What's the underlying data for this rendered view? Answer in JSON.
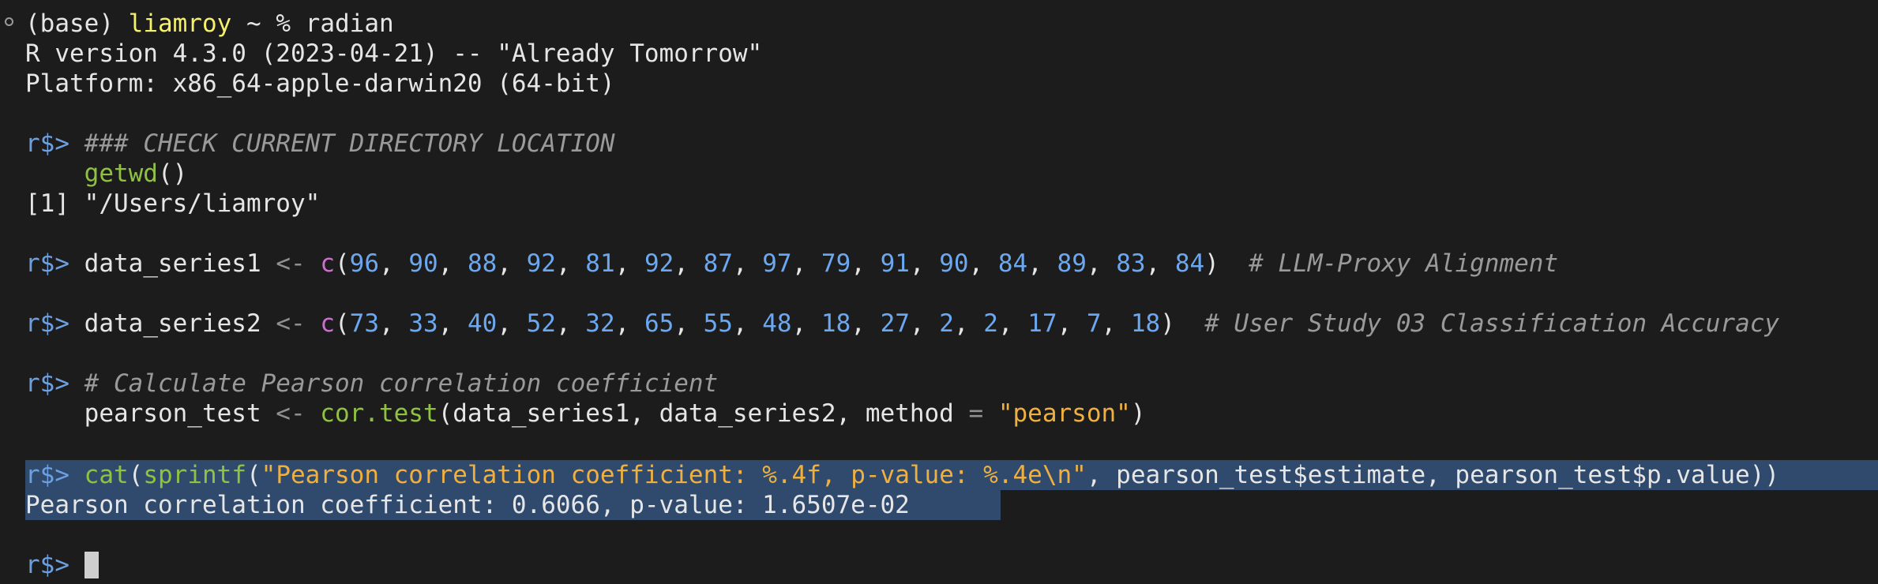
{
  "shell": {
    "env": "(base)",
    "user": "liamroy",
    "dir": "~",
    "symbol": "%",
    "command": "radian"
  },
  "banner": {
    "version": "R version 4.3.0 (2023-04-21) -- \"Already Tomorrow\"",
    "platform": "Platform: x86_64-apple-darwin20 (64-bit)"
  },
  "prompt": "r$>",
  "block1": {
    "comment": "### CHECK CURRENT DIRECTORY LOCATION",
    "fn": "getwd",
    "parens": "()",
    "output": "[1] \"/Users/liamroy\""
  },
  "block2": {
    "var": "data_series1",
    "assign": "<-",
    "fn": "c",
    "values": [
      "96",
      "90",
      "88",
      "92",
      "81",
      "92",
      "87",
      "97",
      "79",
      "91",
      "90",
      "84",
      "89",
      "83",
      "84"
    ],
    "comment": "# LLM-Proxy Alignment"
  },
  "block3": {
    "var": "data_series2",
    "assign": "<-",
    "fn": "c",
    "values": [
      "73",
      "33",
      "40",
      "52",
      "32",
      "65",
      "55",
      "48",
      "18",
      "27",
      "2",
      "2",
      "17",
      "7",
      "18"
    ],
    "comment": "# User Study 03 Classification Accuracy"
  },
  "block4": {
    "comment": "# Calculate Pearson correlation coefficient",
    "var": "pearson_test",
    "assign": "<-",
    "fn": "cor.test",
    "args_open": "(data_series1, data_series2, method ",
    "eq": "=",
    "str": "\"pearson\"",
    "close": ")"
  },
  "block5": {
    "fn1": "cat",
    "fn2": "sprintf",
    "open1": "(",
    "open2": "(",
    "str": "\"Pearson correlation coefficient: %.4f, p-value: %.4e\\n\"",
    "rest": ", pearson_test$estimate, pearson_test$p.value))",
    "output": "Pearson correlation coefficient: 0.6066, p-value: 1.6507e-02"
  },
  "colors": {
    "background": "#1c1c1c",
    "prompt": "#6ca0e0",
    "user": "#f6f16b",
    "function": "#8fc142",
    "number": "#6ca8f0",
    "string": "#f0b040",
    "comment": "#9a9a9a",
    "selection": "#2f4a6d"
  }
}
